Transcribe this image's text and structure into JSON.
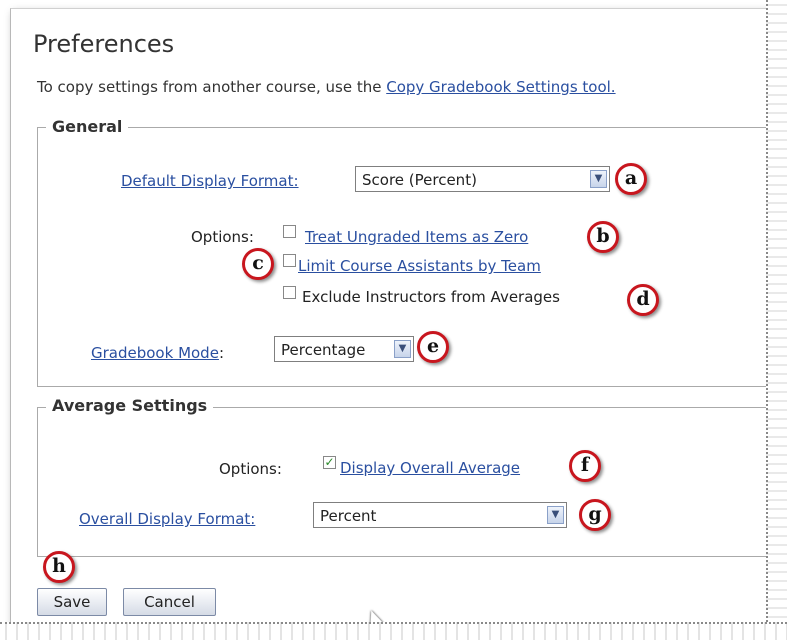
{
  "page": {
    "title": "Preferences",
    "intro_text": "To copy settings from another course, use the",
    "intro_link": "Copy Gradebook Settings tool."
  },
  "general": {
    "legend": "General",
    "default_display_format_label": "Default Display Format:",
    "default_display_format_value": "Score (Percent)",
    "options_label": "Options:",
    "options": [
      {
        "label": "Treat Ungraded Items as Zero",
        "checked": false,
        "is_link": true
      },
      {
        "label": "Limit Course Assistants by Team",
        "checked": false,
        "is_link": true
      },
      {
        "label": "Exclude Instructors from Averages",
        "checked": false,
        "is_link": false
      }
    ],
    "gradebook_mode_label": "Gradebook Mode",
    "gradebook_mode_colon": ":",
    "gradebook_mode_value": "Percentage"
  },
  "average_settings": {
    "legend": "Average Settings",
    "options_label": "Options:",
    "display_overall_average_label": "Display Overall Average",
    "display_overall_average_checked": true,
    "overall_display_format_label": "Overall Display Format:",
    "overall_display_format_value": "Percent"
  },
  "buttons": {
    "save": "Save",
    "cancel": "Cancel"
  },
  "callouts": {
    "a": "a",
    "b": "b",
    "c": "c",
    "d": "d",
    "e": "e",
    "f": "f",
    "g": "g",
    "h": "h"
  },
  "icons": {
    "dropdown_arrow": "chevron-down-icon",
    "check": "checkmark-icon"
  },
  "colors": {
    "link": "#2a4fa0",
    "callout_ring": "#c8161e",
    "check": "#2a8a2a"
  }
}
